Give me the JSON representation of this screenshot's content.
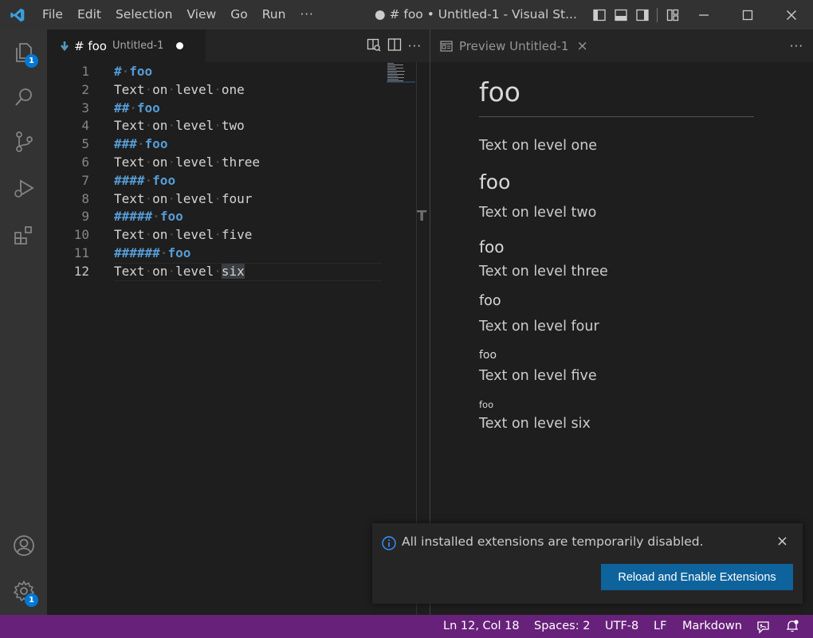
{
  "menu": [
    "File",
    "Edit",
    "Selection",
    "View",
    "Go",
    "Run",
    "···"
  ],
  "window_title": "● # foo • Untitled-1 - Visual St...",
  "activity": {
    "explorer_badge": "1",
    "manage_badge": "1"
  },
  "editor": {
    "tab_name": "# foo",
    "tab_description": "Untitled-1",
    "more_actions": "···",
    "active_line": 12,
    "lines": [
      {
        "n": "1",
        "heading": true,
        "marker": "#",
        "text": "foo"
      },
      {
        "n": "2",
        "heading": false,
        "words": [
          "Text",
          "on",
          "level",
          "one"
        ]
      },
      {
        "n": "3",
        "heading": true,
        "marker": "##",
        "text": "foo"
      },
      {
        "n": "4",
        "heading": false,
        "words": [
          "Text",
          "on",
          "level",
          "two"
        ]
      },
      {
        "n": "5",
        "heading": true,
        "marker": "###",
        "text": "foo"
      },
      {
        "n": "6",
        "heading": false,
        "words": [
          "Text",
          "on",
          "level",
          "three"
        ]
      },
      {
        "n": "7",
        "heading": true,
        "marker": "####",
        "text": "foo"
      },
      {
        "n": "8",
        "heading": false,
        "words": [
          "Text",
          "on",
          "level",
          "four"
        ]
      },
      {
        "n": "9",
        "heading": true,
        "marker": "#####",
        "text": "foo"
      },
      {
        "n": "10",
        "heading": false,
        "words": [
          "Text",
          "on",
          "level",
          "five"
        ]
      },
      {
        "n": "11",
        "heading": true,
        "marker": "######",
        "text": "foo"
      },
      {
        "n": "12",
        "heading": false,
        "words": [
          "Text",
          "on",
          "level",
          "six"
        ]
      }
    ],
    "sash_label": "T"
  },
  "preview": {
    "tab_name": "Preview Untitled-1",
    "close": "×",
    "more_actions": "···",
    "blocks": [
      {
        "kind": "h1",
        "text": "foo"
      },
      {
        "kind": "p",
        "text": "Text on level one"
      },
      {
        "kind": "h2",
        "text": "foo"
      },
      {
        "kind": "p",
        "text": "Text on level two"
      },
      {
        "kind": "h3",
        "text": "foo"
      },
      {
        "kind": "p",
        "text": "Text on level three"
      },
      {
        "kind": "h4",
        "text": "foo"
      },
      {
        "kind": "p",
        "text": "Text on level four"
      },
      {
        "kind": "h5",
        "text": "foo"
      },
      {
        "kind": "p",
        "text": "Text on level five"
      },
      {
        "kind": "h6",
        "text": "foo"
      },
      {
        "kind": "p",
        "text": "Text on level six"
      }
    ]
  },
  "notification": {
    "message": "All installed extensions are temporarily disabled.",
    "button": "Reload and Enable Extensions",
    "close": "×"
  },
  "statusbar": {
    "position": "Ln 12, Col 18",
    "spaces": "Spaces: 2",
    "encoding": "UTF-8",
    "eol": "LF",
    "language": "Markdown"
  },
  "colors": {
    "accent": "#0078d4",
    "statusbar": "#68217a",
    "button": "#0e639c",
    "heading": "#569cd6"
  }
}
